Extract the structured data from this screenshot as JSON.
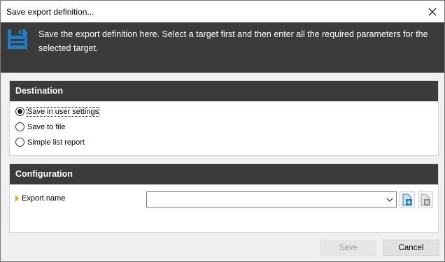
{
  "window": {
    "title": "Save export definition..."
  },
  "banner": {
    "icon": "floppy-disk-icon",
    "text": "Save the export definition here. Select a target first and then enter all the  required parameters for the selected target."
  },
  "destination": {
    "header": "Destination",
    "options": [
      {
        "label": "Save in user settings",
        "checked": true
      },
      {
        "label": "Save to file",
        "checked": false
      },
      {
        "label": "Simple list report",
        "checked": false
      }
    ]
  },
  "configuration": {
    "header": "Configuration",
    "export_name": {
      "label": "Export name",
      "value": ""
    }
  },
  "footer": {
    "save_label": "Save",
    "save_enabled": false,
    "cancel_label": "Cancel"
  },
  "colors": {
    "header_bg": "#3b3b3b",
    "accent_blue": "#1e7fc4",
    "required_marker": "#e8a317"
  }
}
